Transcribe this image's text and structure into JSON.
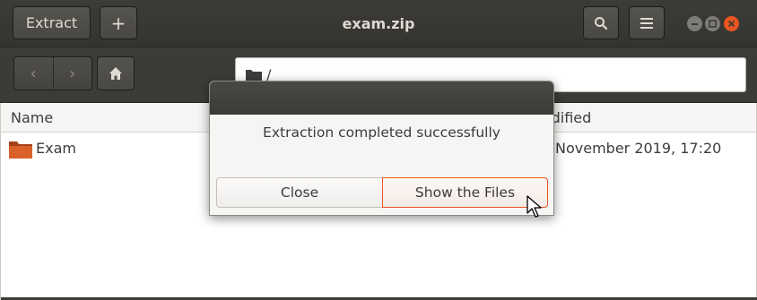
{
  "window": {
    "title": "exam.zip"
  },
  "header": {
    "extract_label": "Extract",
    "add_label": "+",
    "search_icon": "search-icon",
    "menu_icon": "menu-icon"
  },
  "location": {
    "back_glyph": "‹",
    "forward_glyph": "›",
    "path": "/"
  },
  "list": {
    "columns": {
      "name": "Name",
      "modified": "Modified"
    },
    "rows": [
      {
        "name": "Exam",
        "modified": "November 2019, 17:20"
      }
    ]
  },
  "dialog": {
    "message": "Extraction completed successfully",
    "close_label": "Close",
    "show_files_label": "Show the Files"
  },
  "colors": {
    "accent": "#e95420",
    "headerbar": "#3c3b37",
    "folder": "#c9521c"
  }
}
